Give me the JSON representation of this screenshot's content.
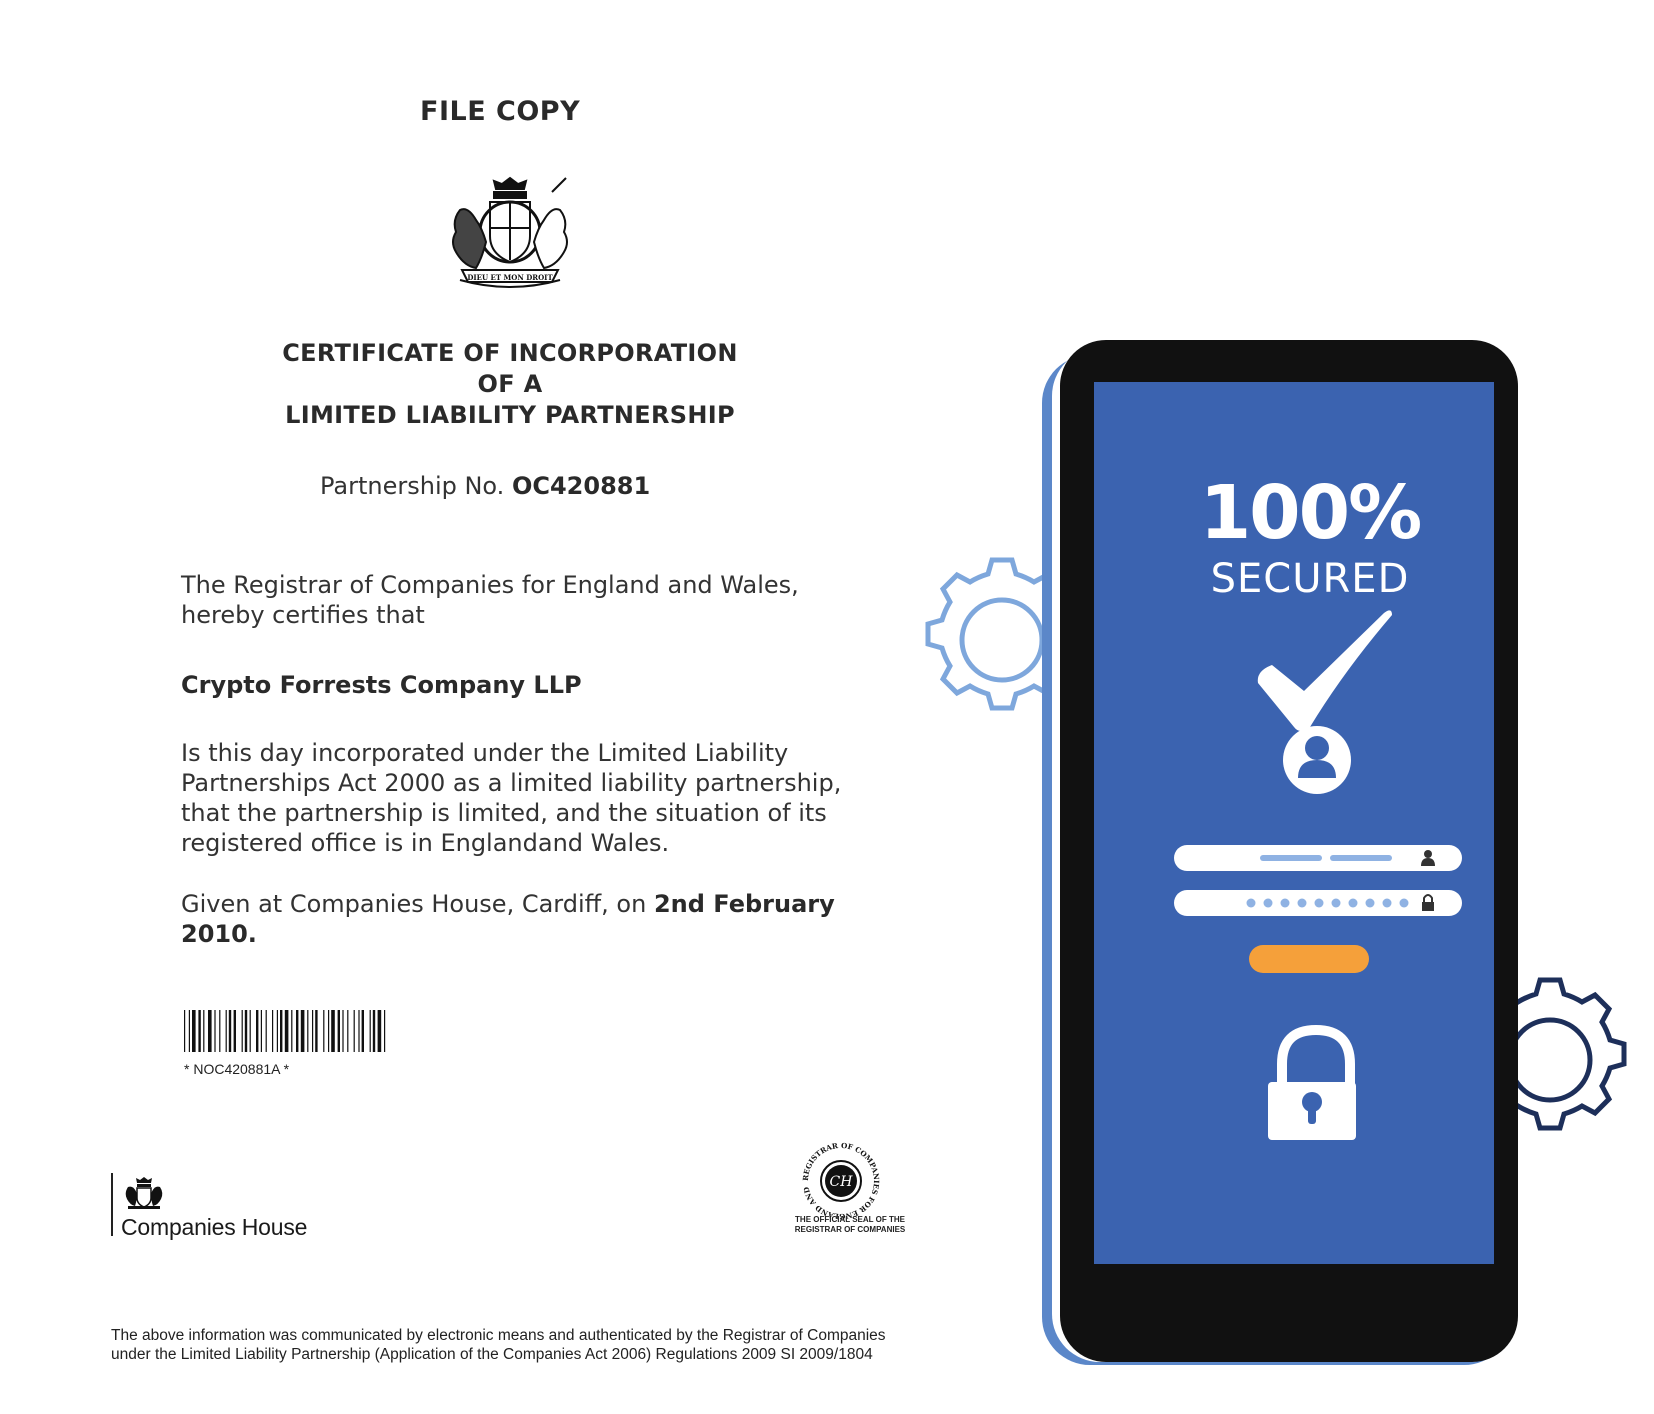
{
  "document": {
    "header": "FILE COPY",
    "title_line1": "CERTIFICATE OF INCORPORATION",
    "title_line2": "OF  A",
    "title_line3": "LIMITED LIABILITY PARTNERSHIP",
    "partnership_label": "Partnership No. ",
    "partnership_number": "OC420881",
    "registrar_line1": "The Registrar of Companies for England and Wales,",
    "registrar_line2": "hereby certifies that",
    "company_name": "Crypto Forrests Company LLP",
    "incorporated_line1": "Is this day incorporated under the Limited Liability",
    "incorporated_line2": "Partnerships  Act 2000 as a limited liability partnership,",
    "incorporated_line3": "that the partnership is limited, and the situation of its",
    "incorporated_line4": "registered office is in Englandand Wales.",
    "given_prefix": "Given at Companies House, Cardiff, on ",
    "given_date": "2nd February 2010.",
    "barcode_text": "* NOC420881A *",
    "logo_text": "Companies House",
    "seal_ring_text": "REGISTRAR OF COMPANIES FOR ENGLAND AND WALES",
    "seal_monogram": "CH",
    "seal_caption_line1": "THE OFFICIAL SEAL OF THE",
    "seal_caption_line2": "REGISTRAR OF COMPANIES",
    "crest_motto": "DIEU ET MON DROIT",
    "footer_line1": "The above information was communicated by electronic means and authenticated by the Registrar of Companies",
    "footer_line2": "under the  Limited Liability Partnership (Application of the Companies Act 2006) Regulations 2009 SI 2009/1804"
  },
  "illustration": {
    "headline": "100%",
    "subline": "SECURED",
    "icons": [
      "gear-icon",
      "checkmark-icon",
      "user-icon",
      "username-field",
      "password-field",
      "login-button",
      "padlock-icon"
    ],
    "colors": {
      "screen": "#3b63b0",
      "phone_body": "#111111",
      "phone_side": "#5b87c9",
      "gear_light": "#7ea7dc",
      "gear_dark": "#1d2f5a",
      "field": "#ffffff",
      "field_dots": "#8fb2e3",
      "button": "#f5a03a"
    }
  }
}
